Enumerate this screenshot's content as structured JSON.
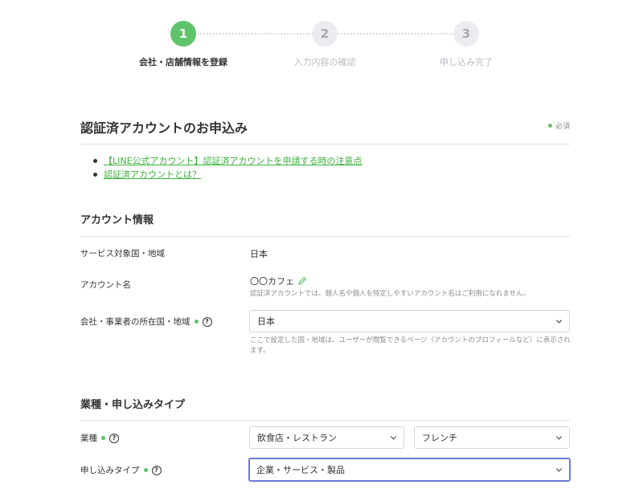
{
  "stepper": {
    "steps": [
      {
        "number": "1",
        "label": "会社・店舗情報を登録"
      },
      {
        "number": "2",
        "label": "入力内容の確認"
      },
      {
        "number": "3",
        "label": "申し込み完了"
      }
    ]
  },
  "header": {
    "title": "認証済アカウントのお申込み",
    "required_note": "必須"
  },
  "links": [
    "【LINE公式アカウント】認証済アカウントを申請する時の注意点",
    "認証済アカウントとは？"
  ],
  "account_section": {
    "title": "アカウント情報",
    "service_country_label": "サービス対象国・地域",
    "service_country_value": "日本",
    "account_name_label": "アカウント名",
    "account_name_value": "〇〇カフェ",
    "account_name_hint": "認証済アカウントでは、個人名や個人を特定しやすいアカウント名はご利用になれません。",
    "company_country_label": "会社・事業者の所在国・地域",
    "company_country_value": "日本",
    "company_country_hint_line1": "ここで設定した国・地域は、ユーザーが閲覧できるページ（アカウントのプロフィールなど）に表示され",
    "company_country_hint_line2": "ます。"
  },
  "industry_section": {
    "title": "業種・申し込みタイプ",
    "industry_label": "業種",
    "industry_value_1": "飲食店・レストラン",
    "industry_value_2": "フレンチ",
    "application_type_label": "申し込みタイプ",
    "application_type_value": "企業・サービス・製品"
  },
  "colors": {
    "accent_green": "#5fc36a",
    "link_green": "#3cb03c",
    "focus_blue": "#6a7ad9"
  }
}
